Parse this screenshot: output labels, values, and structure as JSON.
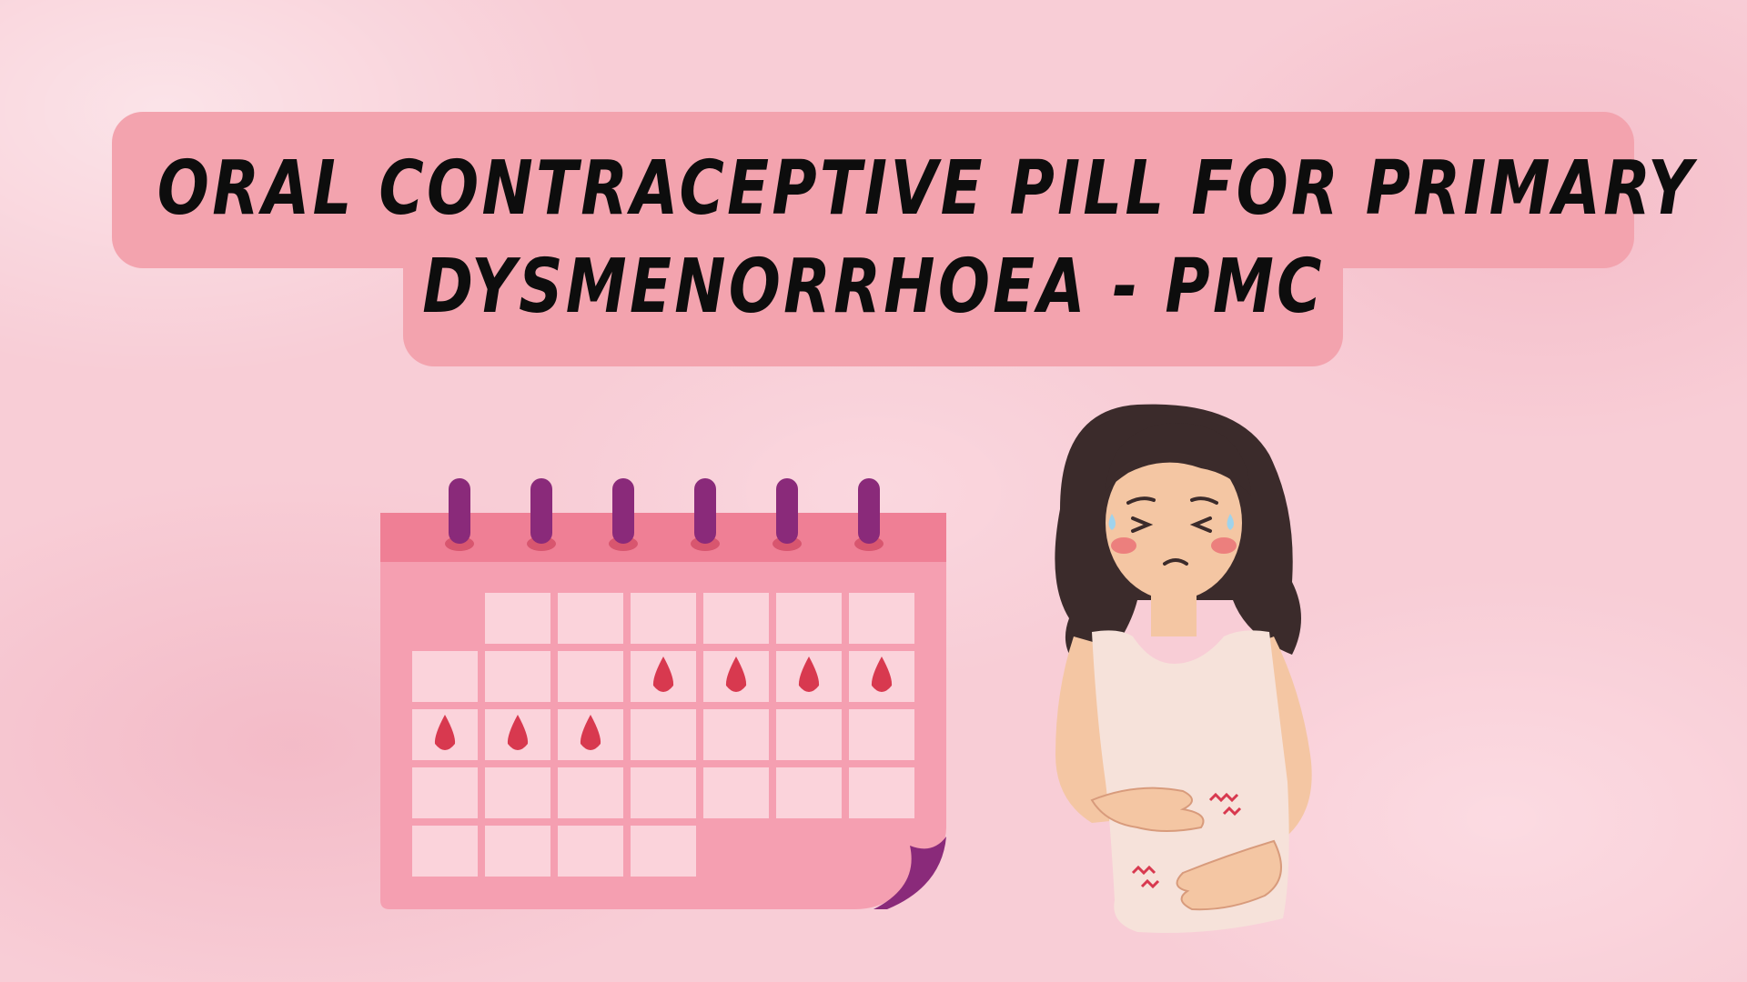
{
  "title": {
    "line1": "ORAL CONTRACEPTIVE PILL FOR PRIMARY",
    "line2": "DYSMENORRHOEA - PMC"
  },
  "illustrations": {
    "calendar": {
      "icon": "menstrual-calendar-icon",
      "rings": 6,
      "rows": 5,
      "columns": 7,
      "period_days": [
        {
          "row": 2,
          "col": 4
        },
        {
          "row": 2,
          "col": 5
        },
        {
          "row": 2,
          "col": 6
        },
        {
          "row": 2,
          "col": 7
        },
        {
          "row": 3,
          "col": 1
        },
        {
          "row": 3,
          "col": 2
        },
        {
          "row": 3,
          "col": 3
        }
      ]
    },
    "woman": {
      "icon": "woman-cramps-icon"
    }
  },
  "colors": {
    "background": "#f8cdd6",
    "title_box": "#f3a3ae",
    "title_text": "#0d0d0d",
    "calendar_body": "#f59fb1",
    "calendar_header": "#ef7f95",
    "calendar_cell": "#fbd3db",
    "ring": "#8a2a7a",
    "blood_drop": "#d8394f"
  }
}
